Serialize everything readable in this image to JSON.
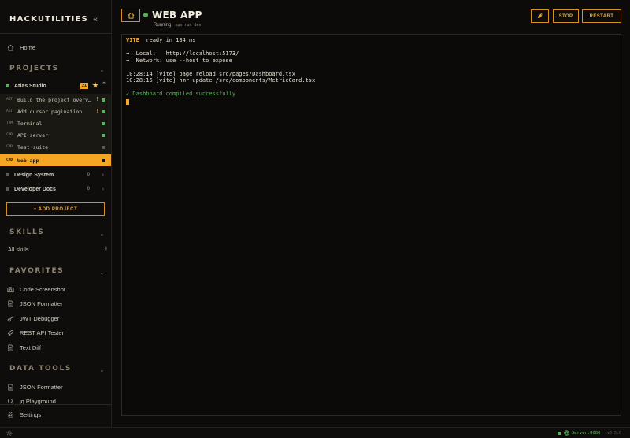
{
  "app": {
    "brand": "HACKUTILITIES",
    "collapse_glyph": "«"
  },
  "nav": {
    "home": "Home",
    "settings": "Settings"
  },
  "projects": {
    "heading": "PROJECTS",
    "items": [
      {
        "name": "Atlas Studio",
        "badge": "21",
        "starred": true,
        "expanded": true,
        "status_color": "#56b35a"
      },
      {
        "name": "Design System",
        "count": "0",
        "status_color": "#5d5a54"
      },
      {
        "name": "Developer Docs",
        "count": "0",
        "status_color": "#5d5a54"
      }
    ],
    "sessions": [
      {
        "kind": "AGT",
        "name": "Build the project overv…",
        "marker": "!",
        "status_color": "#56b35a"
      },
      {
        "kind": "AGT",
        "name": "Add cursor pagination",
        "marker": "!",
        "status_color": "#56b35a"
      },
      {
        "kind": "TRM",
        "name": "Terminal",
        "marker": "",
        "status_color": "#56b35a"
      },
      {
        "kind": "CMD",
        "name": "API server",
        "marker": "",
        "status_color": "#56b35a"
      },
      {
        "kind": "CMD",
        "name": "Test suite",
        "marker": "",
        "status_color": "#5d5a54"
      },
      {
        "kind": "CMD",
        "name": "Web app",
        "marker": "",
        "status_color": "#1a1205",
        "active": true
      }
    ],
    "add_label": "+ ADD PROJECT"
  },
  "skills": {
    "heading": "SKILLS",
    "all_label": "All skills",
    "count": "8"
  },
  "favorites": {
    "heading": "FAVORITES",
    "items": [
      {
        "label": "Code Screenshot",
        "icon": "camera-icon"
      },
      {
        "label": "JSON Formatter",
        "icon": "file-icon"
      },
      {
        "label": "JWT Debugger",
        "icon": "key-icon"
      },
      {
        "label": "REST API Tester",
        "icon": "rocket-icon"
      },
      {
        "label": "Text Diff",
        "icon": "file-icon"
      }
    ]
  },
  "data_tools": {
    "heading": "DATA TOOLS",
    "items": [
      {
        "label": "JSON Formatter",
        "icon": "file-icon"
      },
      {
        "label": "jq Playground",
        "icon": "search-icon"
      }
    ]
  },
  "header": {
    "title": "WEB APP",
    "status": "Running",
    "command": "npm run dev",
    "stop_label": "STOP",
    "restart_label": "RESTART"
  },
  "terminal": {
    "lines": [
      {
        "text": "VITE",
        "rest": "  ready in 184 ms",
        "kind": "vite"
      },
      {
        "text": "",
        "kind": "blank"
      },
      {
        "text": "➜  Local:   http://localhost:5173/",
        "kind": "normal"
      },
      {
        "text": "➜  Network: use --host to expose",
        "kind": "normal"
      },
      {
        "text": "",
        "kind": "blank"
      },
      {
        "text": "10:28:14 [vite] page reload src/pages/Dashboard.tsx",
        "kind": "normal"
      },
      {
        "text": "10:28:16 [vite] hmr update /src/components/MetricCard.tsx",
        "kind": "normal"
      },
      {
        "text": "",
        "kind": "blank"
      },
      {
        "text": "✓ Dashboard compiled successfully",
        "kind": "success"
      }
    ]
  },
  "statusbar": {
    "server": "Server:8080",
    "version": "v3.5.0"
  },
  "colors": {
    "accent": "#f5a623",
    "success": "#56b35a",
    "bg": "#0c0b09"
  }
}
